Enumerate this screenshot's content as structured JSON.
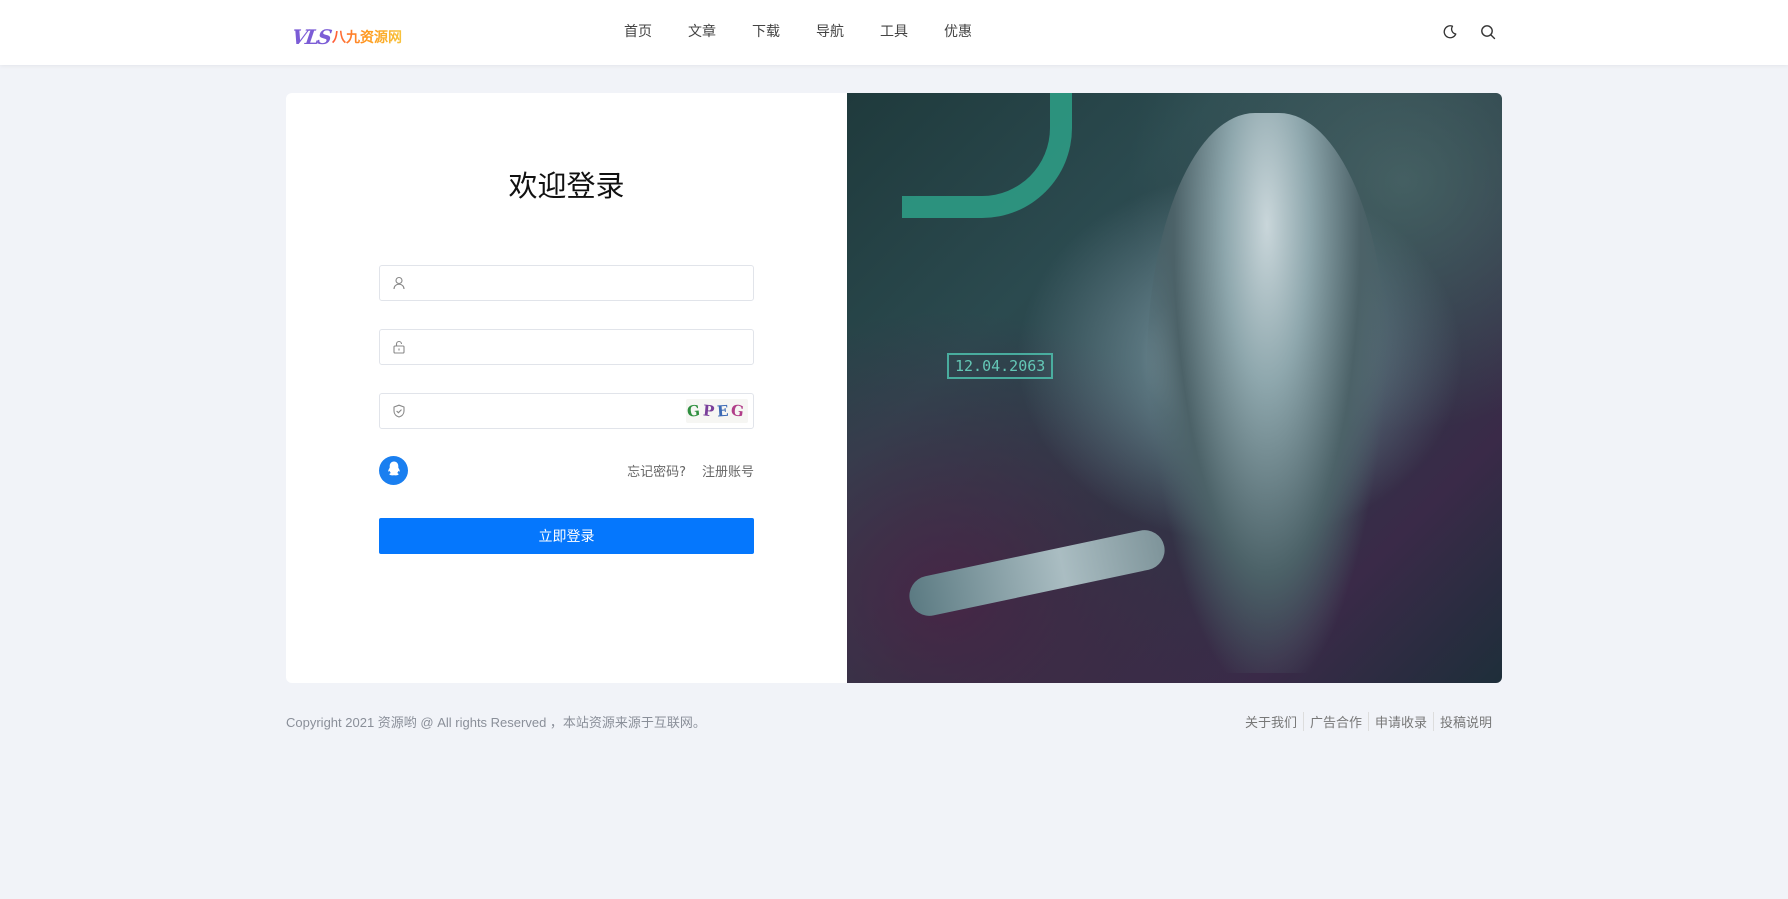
{
  "header": {
    "logo_mark": "VLS",
    "logo_text": "八九资源网",
    "nav": [
      "首页",
      "文章",
      "下载",
      "导航",
      "工具",
      "优惠"
    ],
    "icons": [
      "moon-icon",
      "search-icon"
    ]
  },
  "login": {
    "title": "欢迎登录",
    "username": {
      "value": "",
      "placeholder": ""
    },
    "password": {
      "value": "",
      "placeholder": ""
    },
    "captcha": {
      "value": "",
      "placeholder": "",
      "image_text": [
        "G",
        "P",
        "E",
        "G"
      ]
    },
    "social_icon": "qq-icon",
    "forgot_password": "忘记密码?",
    "register": "注册账号",
    "submit_label": "立即登录"
  },
  "hero_image": {
    "date_text": "12.04.2063"
  },
  "footer": {
    "copyright": "Copyright 2021 资源哟 @ All rights Reserved ，本站资源来源于互联网。",
    "links": [
      "关于我们",
      "广告合作",
      "申请收录",
      "投稿说明"
    ]
  },
  "colors": {
    "accent": "#0577fd",
    "background": "#f1f3f8",
    "qq": "#1a7ff0"
  }
}
